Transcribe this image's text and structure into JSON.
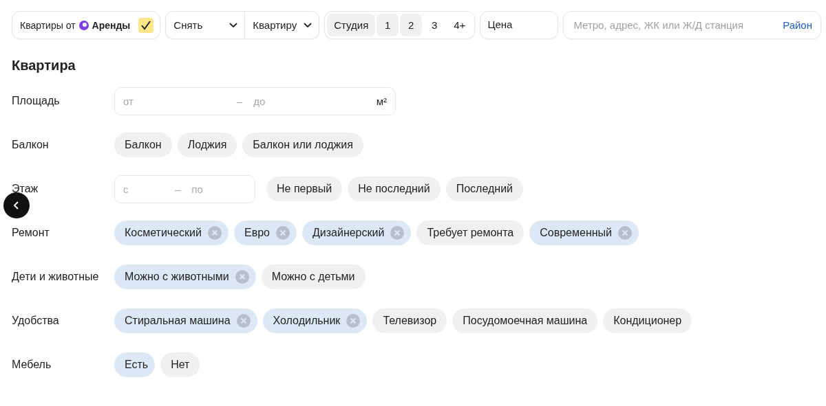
{
  "topbar": {
    "arenda": {
      "label": "Квартиры от",
      "brand": "Аренды",
      "checked": true
    },
    "deal": {
      "label": "Снять"
    },
    "type": {
      "label": "Квартиру"
    },
    "rooms": [
      {
        "label": "Студия",
        "selected": true
      },
      {
        "label": "1",
        "selected": true
      },
      {
        "label": "2",
        "selected": true
      },
      {
        "label": "3",
        "selected": false
      },
      {
        "label": "4+",
        "selected": false
      }
    ],
    "price": {
      "label": "Цена"
    },
    "search": {
      "placeholder": "Метро, адрес, ЖК или Ж/Д станция",
      "link": "Район"
    }
  },
  "section_title": "Квартира",
  "rows": [
    {
      "label": "Площадь",
      "range": {
        "from": "от",
        "separator": "–",
        "to": "до",
        "unit": "м²"
      }
    },
    {
      "label": "Балкон",
      "chips": [
        {
          "label": "Балкон",
          "selected": false
        },
        {
          "label": "Лоджия",
          "selected": false
        },
        {
          "label": "Балкон или лоджия",
          "selected": false
        }
      ]
    },
    {
      "label": "Этаж",
      "range": {
        "from": "с",
        "separator": "–",
        "to": "по"
      },
      "chips": [
        {
          "label": "Не первый",
          "selected": false
        },
        {
          "label": "Не последний",
          "selected": false
        },
        {
          "label": "Последний",
          "selected": false
        }
      ]
    },
    {
      "label": "Ремонт",
      "chips": [
        {
          "label": "Косметический",
          "selected": true
        },
        {
          "label": "Евро",
          "selected": true
        },
        {
          "label": "Дизайнерский",
          "selected": true
        },
        {
          "label": "Требует ремонта",
          "selected": false
        },
        {
          "label": "Современный",
          "selected": true
        }
      ]
    },
    {
      "label": "Дети и животные",
      "chips": [
        {
          "label": "Можно с животными",
          "selected": true
        },
        {
          "label": "Можно с детьми",
          "selected": false
        }
      ]
    },
    {
      "label": "Удобства",
      "chips": [
        {
          "label": "Стиральная машина",
          "selected": true
        },
        {
          "label": "Холодильник",
          "selected": true
        },
        {
          "label": "Телевизор",
          "selected": false
        },
        {
          "label": "Посудомоечная машина",
          "selected": false
        },
        {
          "label": "Кондиционер",
          "selected": false
        }
      ]
    },
    {
      "label": "Мебель",
      "chips": [
        {
          "label": "Есть",
          "selected": true,
          "removable": false
        },
        {
          "label": "Нет",
          "selected": false
        }
      ]
    }
  ]
}
